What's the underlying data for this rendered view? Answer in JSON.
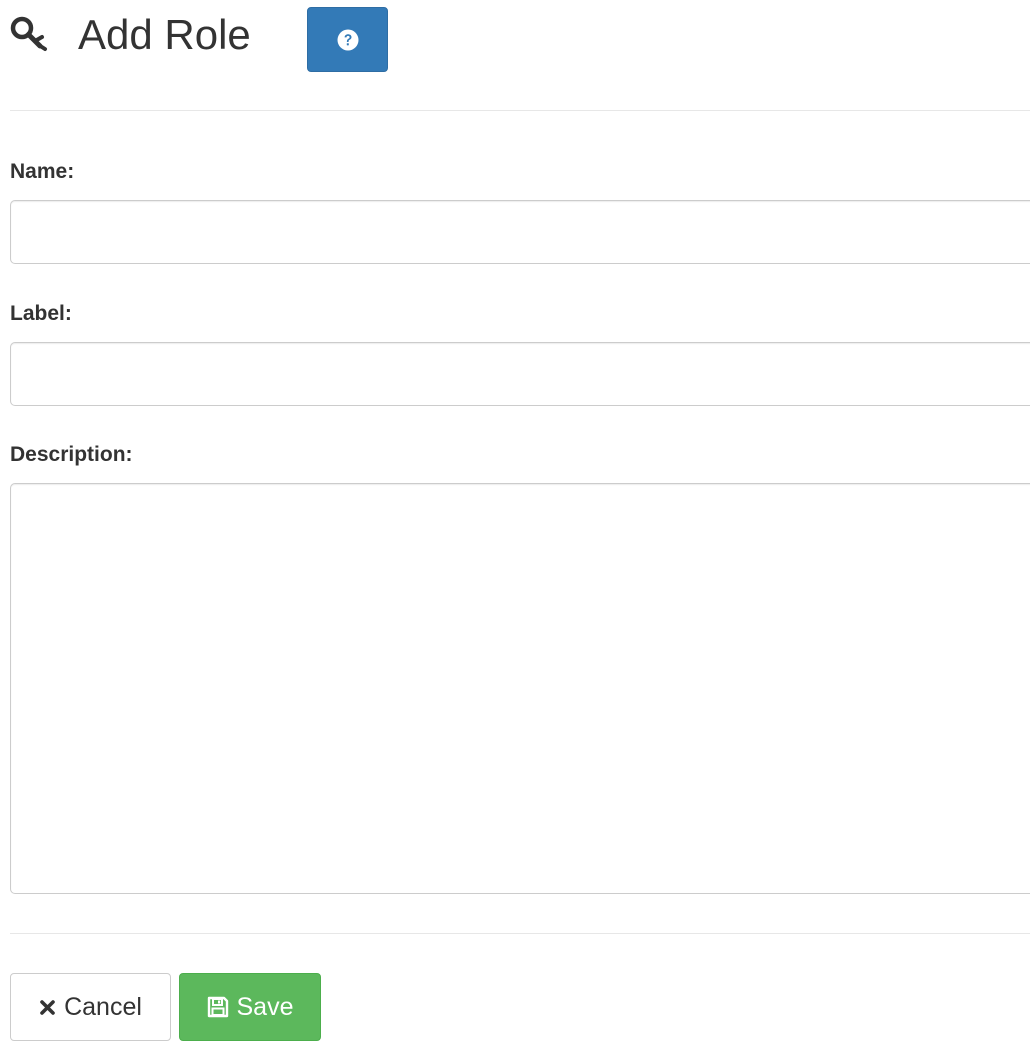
{
  "header": {
    "title": "Add Role",
    "title_icon": "key-icon",
    "help_icon": "question-circle-icon"
  },
  "form": {
    "name": {
      "label": "Name:",
      "value": "",
      "placeholder": ""
    },
    "label": {
      "label": "Label:",
      "value": "",
      "placeholder": ""
    },
    "description": {
      "label": "Description:",
      "value": "",
      "placeholder": ""
    }
  },
  "actions": {
    "cancel_label": "Cancel",
    "cancel_icon": "times-icon",
    "save_label": "Save",
    "save_icon": "floppy-disk-icon"
  },
  "colors": {
    "primary": "#337ab7",
    "success": "#5cb85c",
    "text": "#333333",
    "border": "#cccccc"
  }
}
